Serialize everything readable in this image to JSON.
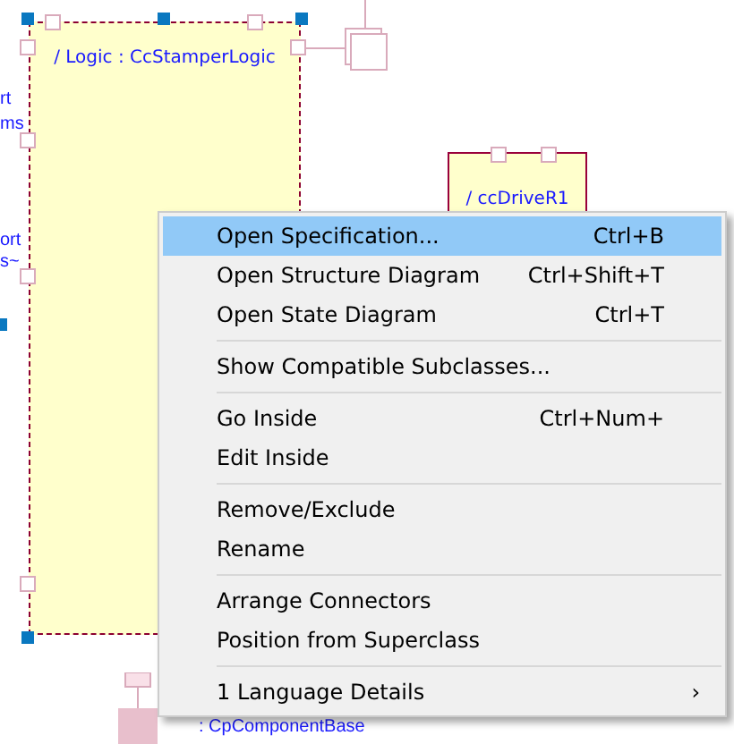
{
  "diagram": {
    "parts": [
      {
        "label": "/ Logic : CcStamperLogic",
        "selected": true
      },
      {
        "label": "/ ccDriveR1",
        "selected": false
      }
    ],
    "labels": [
      {
        "text": "rt"
      },
      {
        "text": "ms"
      },
      {
        "text": "ort"
      },
      {
        "text": "s~"
      },
      {
        "text": ": CpComponentBase"
      }
    ]
  },
  "menu": {
    "items": [
      {
        "kind": "item",
        "label": "Open Specification...",
        "shortcut": "Ctrl+B",
        "selected": true
      },
      {
        "kind": "item",
        "label": "Open Structure Diagram",
        "shortcut": "Ctrl+Shift+T",
        "selected": false
      },
      {
        "kind": "item",
        "label": "Open State Diagram",
        "shortcut": "Ctrl+T",
        "selected": false
      },
      {
        "kind": "separator"
      },
      {
        "kind": "item",
        "label": "Show Compatible Subclasses...",
        "selected": false
      },
      {
        "kind": "separator"
      },
      {
        "kind": "item",
        "label": "Go Inside",
        "shortcut": "Ctrl+Num+",
        "selected": false
      },
      {
        "kind": "item",
        "label": "Edit Inside",
        "selected": false
      },
      {
        "kind": "separator"
      },
      {
        "kind": "item",
        "label": "Remove/Exclude",
        "selected": false
      },
      {
        "kind": "item",
        "label": "Rename",
        "selected": false
      },
      {
        "kind": "separator"
      },
      {
        "kind": "item",
        "label": "Arrange Connectors",
        "selected": false
      },
      {
        "kind": "item",
        "label": "Position from Superclass",
        "selected": false
      },
      {
        "kind": "separator"
      },
      {
        "kind": "submenu",
        "label": "1 Language Details",
        "arrow": "›",
        "selected": false
      }
    ]
  }
}
